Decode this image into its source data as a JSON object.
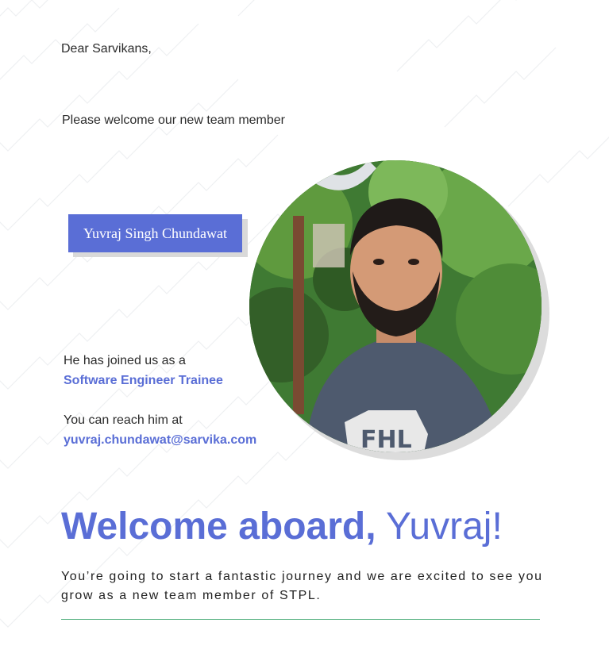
{
  "greeting": "Dear Sarvikans,",
  "intro": "Please welcome our new team member",
  "member": {
    "name": "Yuvraj Singh Chundawat",
    "role_intro": "He has joined us as a",
    "role": "Software Engineer Trainee",
    "reach_intro": "You can reach him at",
    "email": "yuvraj.chundawat@sarvika.com",
    "shirt_text": "FHL"
  },
  "headline": {
    "bold": "Welcome aboard,",
    "light": "Yuvraj!"
  },
  "tagline": "You’re going to start a fantastic journey and we are excited to see you grow as a new team member of STPL.",
  "colors": {
    "accent": "#5a6ed6",
    "divider": "#59b383",
    "text": "#222222"
  }
}
